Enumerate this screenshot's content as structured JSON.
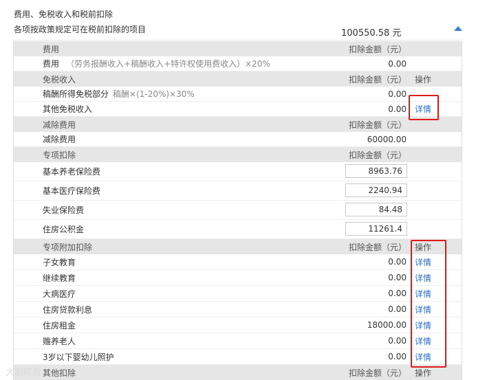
{
  "header": {
    "title": "费用、免税收入和税前扣除",
    "subtitle": "各项按政策规定可在税前扣除的项目",
    "total": "100550.58 元"
  },
  "columns": {
    "amount": "扣除金额（元）",
    "action": "操作",
    "link": "详情"
  },
  "sections": {
    "expenses": {
      "title": "费用",
      "rows": [
        {
          "label": "费用",
          "note": "（劳务报酬收入+稿酬收入+特许权使用费收入）×20%",
          "amount": "0.00"
        }
      ]
    },
    "exempt": {
      "title": "免税收入",
      "rows": [
        {
          "label": "稿酬所得免税部分",
          "note": "稿酬×(1-20%)×30%",
          "amount": "0.00"
        },
        {
          "label": "其他免税收入",
          "amount": "0.00"
        }
      ]
    },
    "reduction": {
      "title": "减除费用",
      "rows": [
        {
          "label": "减除费用",
          "amount": "60000.00"
        }
      ]
    },
    "special": {
      "title": "专项扣除",
      "rows": [
        {
          "label": "基本养老保险费",
          "value": "8963.76"
        },
        {
          "label": "基本医疗保险费",
          "value": "2240.94"
        },
        {
          "label": "失业保险费",
          "value": "84.48"
        },
        {
          "label": "住房公积金",
          "value": "11261.4"
        }
      ]
    },
    "additional": {
      "title": "专项附加扣除",
      "rows": [
        {
          "label": "子女教育",
          "amount": "0.00"
        },
        {
          "label": "继续教育",
          "amount": "0.00"
        },
        {
          "label": "大病医疗",
          "amount": "0.00"
        },
        {
          "label": "住房贷款利息",
          "amount": "0.00"
        },
        {
          "label": "住房租金",
          "amount": "18000.00"
        },
        {
          "label": "赡养老人",
          "amount": "0.00"
        },
        {
          "label": "3岁以下婴幼儿照护",
          "amount": "0.00"
        }
      ]
    },
    "other": {
      "title": "其他扣除"
    }
  },
  "watermark": "大眼睛看"
}
